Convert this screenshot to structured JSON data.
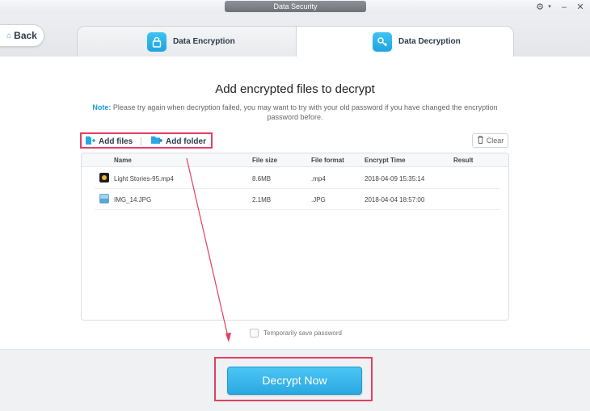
{
  "window": {
    "title": "Data Security"
  },
  "nav": {
    "back_label": "Back"
  },
  "tabs": [
    {
      "label": "Data Encryption",
      "icon": "lock-icon",
      "active": false
    },
    {
      "label": "Data Decryption",
      "icon": "key-icon",
      "active": true
    }
  ],
  "main": {
    "heading": "Add encrypted files to decrypt",
    "note_label": "Note:",
    "note_text": "Please try again when decryption failed, you may want to try with your old password if you have changed the encryption password before."
  },
  "toolbar": {
    "add_files_label": "Add files",
    "add_folder_label": "Add folder",
    "clear_label": "Clear"
  },
  "table": {
    "columns": [
      "Name",
      "File size",
      "File format",
      "Encrypt Time",
      "Result"
    ],
    "rows": [
      {
        "name": "Light Stories-95.mp4",
        "size": "8.6MB",
        "format": ".mp4",
        "time": "2018-04-09 15:35:14",
        "result": "",
        "icon": "video-file-icon"
      },
      {
        "name": "IMG_14.JPG",
        "size": "2.1MB",
        "format": ".JPG",
        "time": "2018-04-04 18:57:00",
        "result": "",
        "icon": "image-file-icon"
      }
    ]
  },
  "options": {
    "save_password_label": "Temporarily save password",
    "save_password_checked": false
  },
  "footer": {
    "decrypt_label": "Decrypt Now"
  },
  "colors": {
    "accent": "#2aa8e2",
    "highlight": "#e24060"
  }
}
